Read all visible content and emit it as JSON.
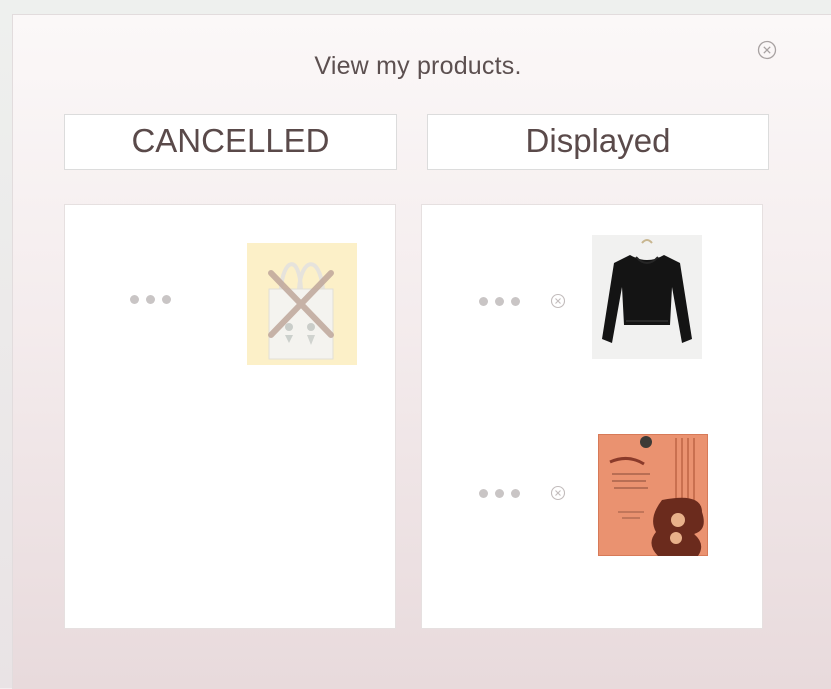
{
  "modal": {
    "title": "View my products.",
    "close_icon": "close-circle-icon"
  },
  "tabs": [
    {
      "label": "CANCELLED"
    },
    {
      "label": "Displayed"
    }
  ],
  "cancelled": {
    "items": [
      {
        "image": "tote-bag",
        "status_mark": "cross-mark-icon"
      }
    ]
  },
  "displayed": {
    "items": [
      {
        "image": "black-cropped-sweater"
      },
      {
        "image": "arabic-book-cover"
      }
    ]
  },
  "colors": {
    "title_text": "#5c5050",
    "tab_text": "#5a4a4a",
    "dots": "#c9c5c5",
    "cancel_mark": "#c8a99c"
  }
}
